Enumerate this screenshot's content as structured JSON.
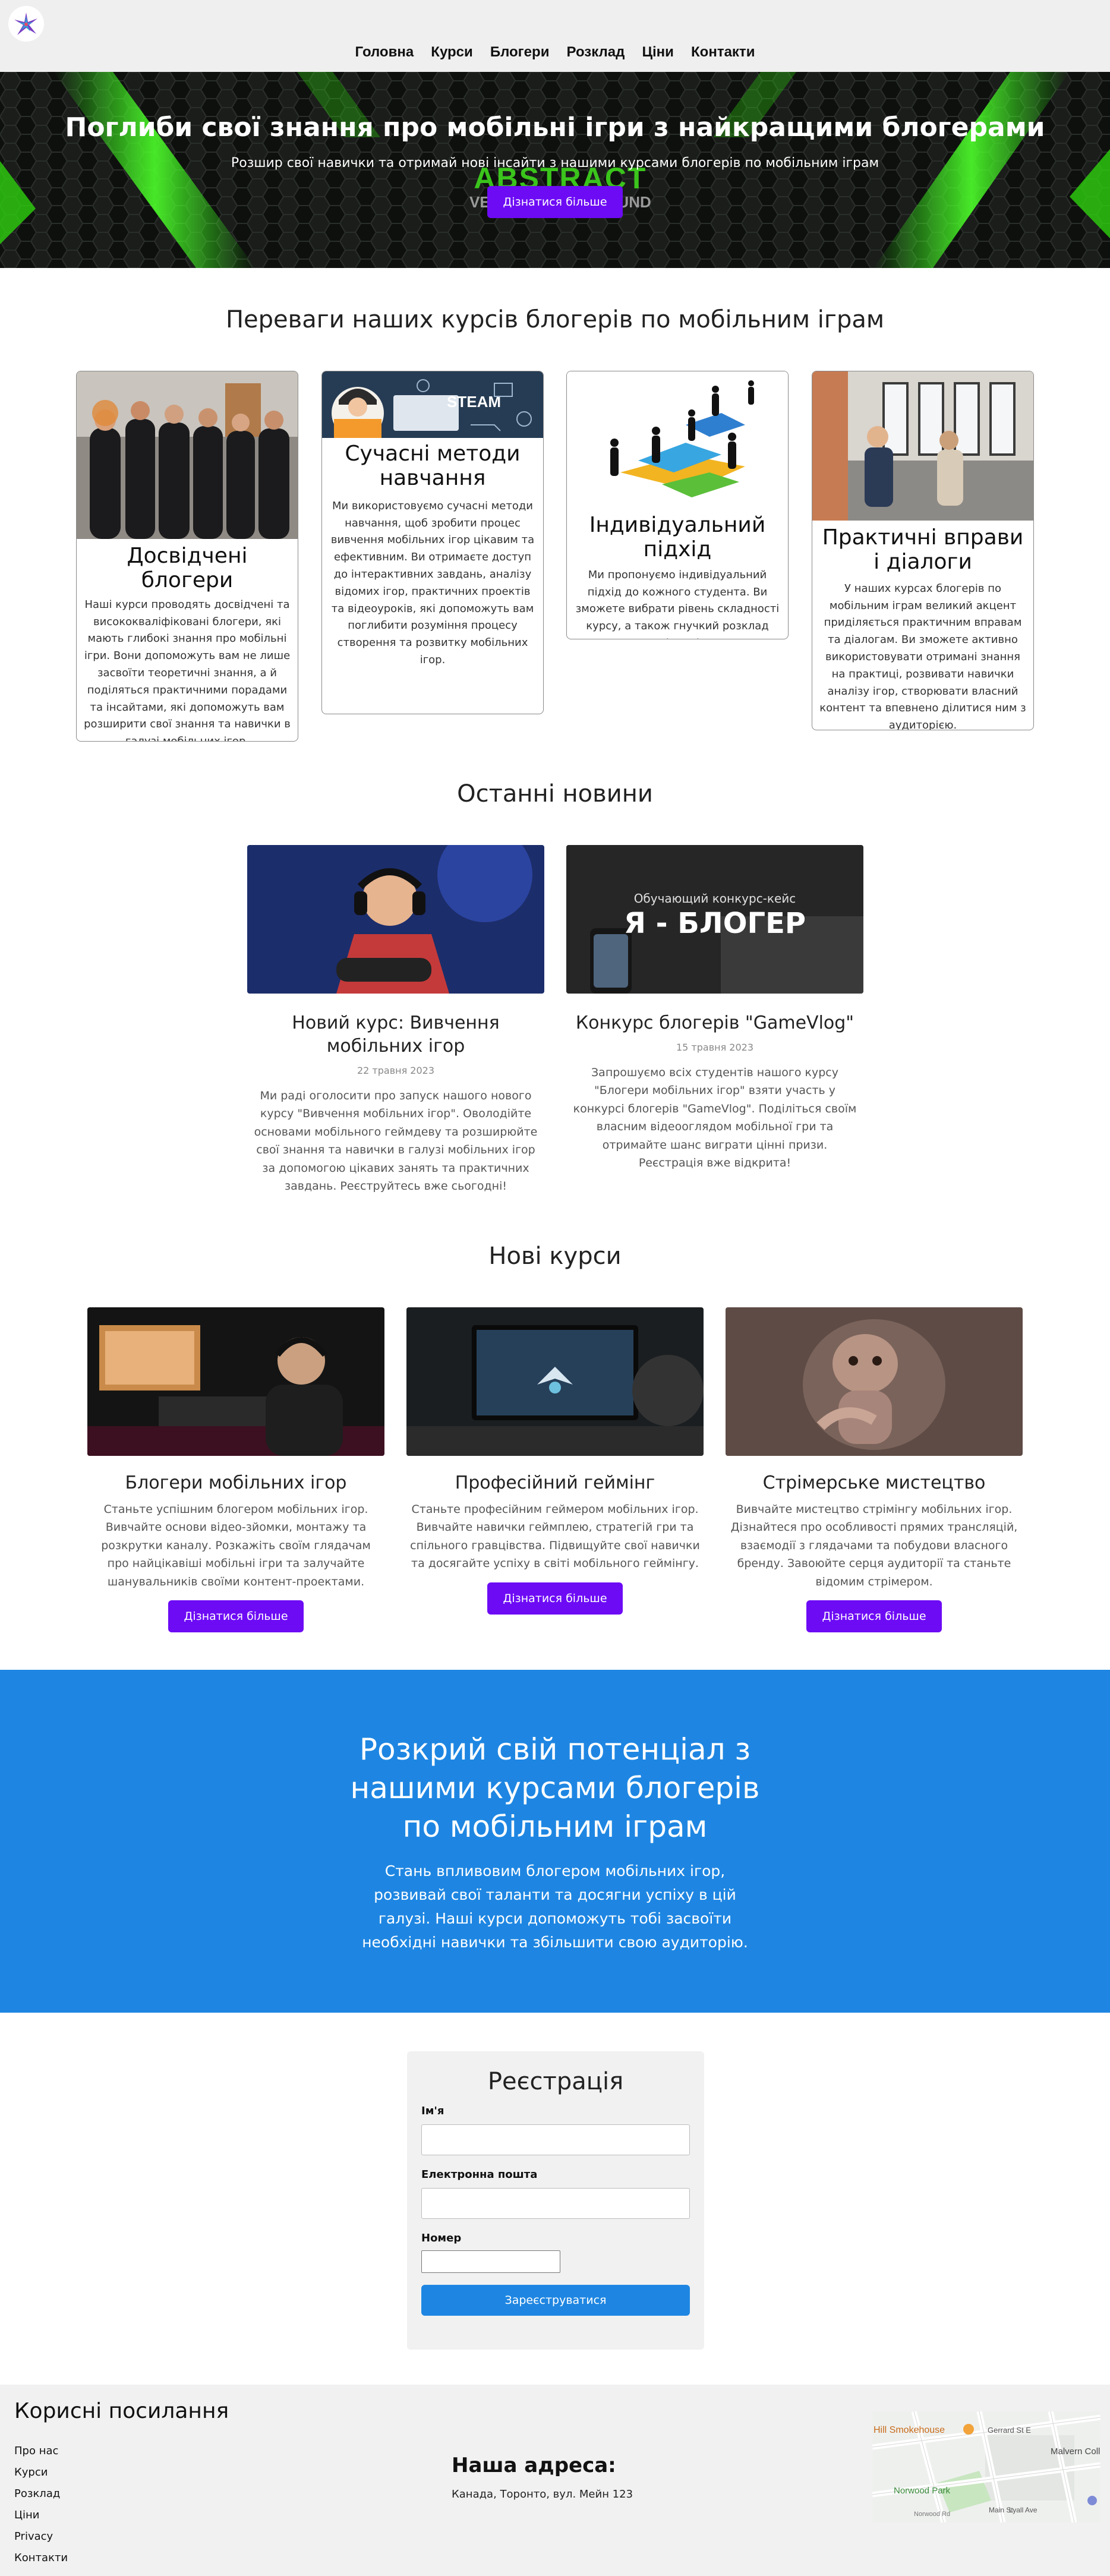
{
  "header": {
    "nav": [
      "Головна",
      "Курси",
      "Блогери",
      "Розклад",
      "Ціни",
      "Контакти"
    ]
  },
  "hero": {
    "title": "Поглиби свої знання про мобільні ігри з найкращими блогерами",
    "subtitle": "Розшир свої навички та отримай нові інсайти з нашими курсами блогерів по мобільним іграм",
    "button": "Дізнатися більше",
    "watermark_main": "ABSTRACT",
    "watermark_sub": "VECTOR BACKGROUND",
    "accent": "#3fd71d"
  },
  "advantages": {
    "title": "Переваги наших курсів блогерів по мобільним іграм",
    "cards": [
      {
        "title": "Досвідчені блогери",
        "text": "Наші курси проводять досвідчені та висококваліфіковані блогери, які мають глибокі знання про мобільні ігри. Вони допоможуть вам не лише засвоїти теоретичні знання, а й поділяться практичними порадами та інсайтами, які допоможуть вам розширити свої знання та навички в галузі мобільних ігор."
      },
      {
        "title": "Сучасні методи навчання",
        "text": "Ми використовуємо сучасні методи навчання, щоб зробити процес вивчення мобільних ігор цікавим та ефективним. Ви отримаєте доступ до інтерактивних завдань, аналізу відомих ігор, практичних проектів та відеоуроків, які допоможуть вам поглибити розуміння процесу створення та розвитку мобільних ігор."
      },
      {
        "title": "Індивідуальний підхід",
        "text": "Ми пропонуємо індивідуальний підхід до кожного студента. Ви зможете вибрати рівень складності курсу, а також гнучкий розклад занять, що відповідає вашим потребам та графіку."
      },
      {
        "title": "Практичні вправи і діалоги",
        "text": "У наших курсах блогерів по мобільним іграм великий акцент приділяється практичним вправам та діалогам. Ви зможете активно використовувати отримані знання на практиці, розвивати навички аналізу ігор, створювати власний контент та впевнено ділитися ним з аудиторією."
      }
    ]
  },
  "news": {
    "title": "Останні новини",
    "items": [
      {
        "title": "Новий курс: Вивчення мобільних ігор",
        "date": "22 травня 2023",
        "text": "Ми раді оголосити про запуск нашого нового курсу \"Вивчення мобільних ігор\". Оволодійте основами мобільного геймдеву та розширюйте свої знання та навички в галузі мобільних ігор за допомогою цікавих занять та практичних завдань. Реєструйтесь вже сьогодні!"
      },
      {
        "title": "Конкурс блогерів \"GameVlog\"",
        "date": "15 травня 2023",
        "text": "Запрошуємо всіх студентів нашого курсу \"Блогери мобільних ігор\" взяти участь у конкурсі блогерів \"GameVlog\". Поділіться своїм власним відеооглядом мобільної гри та отримайте шанс виграти цінні призи. Реєстрація вже відкрита!",
        "image_caption": "Обучающий конкурс-кейс",
        "image_heading": "Я - БЛОГЕР"
      }
    ]
  },
  "courses": {
    "title": "Нові курси",
    "items": [
      {
        "title": "Блогери мобільних ігор",
        "text": "Станьте успішним блогером мобільних ігор. Вивчайте основи відео-зйомки, монтажу та розкрутки каналу. Розкажіть своїм глядачам про найцікавіші мобільні ігри та залучайте шанувальників своїми контент-проектами.",
        "button": "Дізнатися більше"
      },
      {
        "title": "Професійний геймінг",
        "text": "Станьте професійним геймером мобільних ігор. Вивчайте навички геймплею, стратегій гри та спільного гравцівства. Підвищуйте свої навички та досягайте успіху в світі мобільного геймінгу.",
        "button": "Дізнатися більше"
      },
      {
        "title": "Стрімерське мистецтво",
        "text": "Вивчайте мистецтво стрімінгу мобільних ігор. Дізнайтеся про особливості прямих трансляцій, взаємодії з глядачами та побудови власного бренду. Завоюйте серця аудиторії та станьте відомим стрімером.",
        "button": "Дізнатися більше"
      }
    ]
  },
  "cta": {
    "title": "Розкрий свій потенціал з нашими курсами блогерів по мобільним іграм",
    "text": "Стань впливовим блогером мобільних ігор, розвивай свої таланти та досягни успіху в цій галузі. Наші курси допоможуть тобі засвоїти необхідні навички та збільшити свою аудиторію.",
    "color": "#1e86e2"
  },
  "registration": {
    "title": "Реєстрація",
    "name_label": "Ім'я",
    "email_label": "Електронна пошта",
    "phone_label": "Номер",
    "button": "Зареєструватися"
  },
  "footer": {
    "links_title": "Корисні посилання",
    "links": [
      "Про нас",
      "Курси",
      "Розклад",
      "Ціни",
      "Privacy",
      "Контакти"
    ],
    "address_title": "Наша адреса:",
    "address": "Канада, Торонто, вул. Мейн 123",
    "map_labels": {
      "place1": "Hill Smokehouse",
      "place2": "Malvern Collegiate Institute",
      "place3": "Norwood Park",
      "street1": "Gerrard St E",
      "street2": "Main St",
      "street3": "Lyall Ave",
      "street4": "Norwood Rd"
    }
  }
}
